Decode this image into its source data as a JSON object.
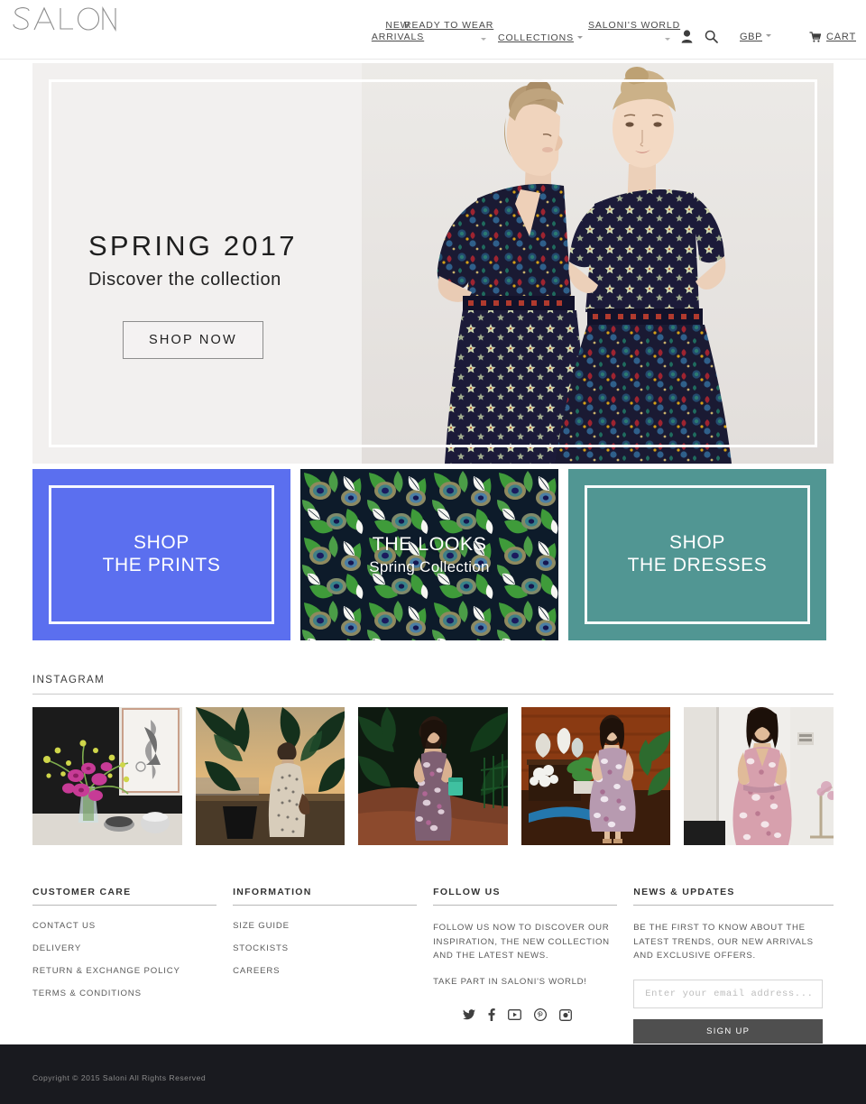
{
  "brand": {
    "name": "SALONI"
  },
  "nav": {
    "items": [
      {
        "label": "NEW ARRIVALS",
        "line1": "NEW",
        "line2": "ARRIVALS",
        "has_dropdown": false
      },
      {
        "label": "READY TO WEAR",
        "has_dropdown": true
      },
      {
        "label": "COLLECTIONS",
        "has_dropdown": true
      },
      {
        "label": "SALONI'S WORLD",
        "has_dropdown": true
      }
    ],
    "account_icon": "user-icon",
    "search_icon": "search-icon",
    "currency": "GBP",
    "cart_label": "CART",
    "cart_icon": "cart-icon"
  },
  "hero": {
    "title": "SPRING 2017",
    "subtitle": "Discover the collection",
    "cta": "SHOP NOW",
    "bg_color": "#f2f0ef"
  },
  "promos": [
    {
      "line1": "SHOP",
      "line2": "THE PRINTS",
      "color": "#5b6fef",
      "kind": "solid"
    },
    {
      "line1": "THE LOOKS",
      "line2": "Spring Collection",
      "color": "#0d1b2a",
      "kind": "pattern"
    },
    {
      "line1": "SHOP",
      "line2": "THE DRESSES",
      "color": "#519693",
      "kind": "solid"
    }
  ],
  "instagram": {
    "heading": "INSTAGRAM",
    "tiles": [
      {
        "alt": "orchids-in-vase-interior"
      },
      {
        "alt": "woman-on-terrace-at-sunset"
      },
      {
        "alt": "woman-in-floral-dress-garden-path"
      },
      {
        "alt": "woman-in-floral-dress-on-talkshow-set"
      },
      {
        "alt": "woman-in-pink-floral-dress-studio"
      }
    ]
  },
  "footer": {
    "columns": [
      {
        "heading": "CUSTOMER CARE",
        "links": [
          "CONTACT US",
          "DELIVERY",
          "RETURN & EXCHANGE POLICY",
          "TERMS & CONDITIONS"
        ]
      },
      {
        "heading": "INFORMATION",
        "links": [
          "SIZE GUIDE",
          "STOCKISTS",
          "CAREERS"
        ]
      }
    ],
    "follow": {
      "heading": "FOLLOW US",
      "text1": "FOLLOW US NOW TO DISCOVER OUR INSPIRATION, THE NEW COLLECTION AND THE LATEST NEWS.",
      "text2": "TAKE PART IN SALONI'S WORLD!",
      "socials": [
        "twitter-icon",
        "facebook-icon",
        "youtube-icon",
        "pinterest-icon",
        "instagram-icon"
      ]
    },
    "news": {
      "heading": "NEWS & UPDATES",
      "text": "BE THE FIRST TO KNOW ABOUT THE LATEST TRENDS, OUR NEW ARRIVALS AND EXCLUSIVE OFFERS.",
      "email_placeholder": "Enter your email address...",
      "email_value": "",
      "signup_label": "SIGN UP"
    }
  },
  "copyright": {
    "text": "Copyright © 2015 Saloni All Rights Reserved",
    "bg_color": "#191a1f"
  }
}
